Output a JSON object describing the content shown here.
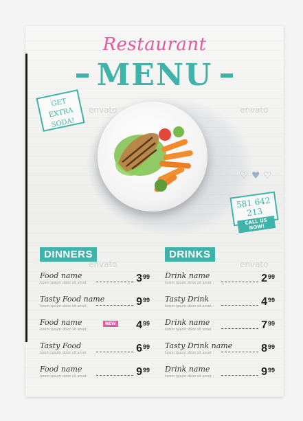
{
  "header": {
    "restaurant": "Restaurant",
    "menu_title": "MENU"
  },
  "stamp": {
    "line1": "GET EXTRA",
    "line2": "SODA!"
  },
  "watermark": "envato",
  "phone_badge": {
    "number": "581 642 213",
    "cta": "CALL US NOW!"
  },
  "dinners": {
    "heading": "DINNERS",
    "items": [
      {
        "name": "Food name",
        "desc": "lorem ipsum dolor sit amet",
        "price": "3",
        "cents": "99",
        "badge": ""
      },
      {
        "name": "Tasty Food name",
        "desc": "lorem ipsum dolor sit amet",
        "price": "9",
        "cents": "99",
        "badge": ""
      },
      {
        "name": "Food name",
        "desc": "lorem ipsum dolor sit amet",
        "price": "4",
        "cents": "99",
        "badge": "NEW"
      },
      {
        "name": "Tasty Food",
        "desc": "lorem ipsum dolor sit amet",
        "price": "6",
        "cents": "99",
        "badge": ""
      },
      {
        "name": "Food name",
        "desc": "lorem ipsum dolor sit amet",
        "price": "9",
        "cents": "99",
        "badge": ""
      }
    ]
  },
  "drinks": {
    "heading": "DRINKS",
    "items": [
      {
        "name": "Drink name",
        "desc": "lorem ipsum dolor sit amet",
        "price": "2",
        "cents": "99"
      },
      {
        "name": "Tasty Drink",
        "desc": "lorem ipsum dolor sit amet",
        "price": "4",
        "cents": "99"
      },
      {
        "name": "Drink name",
        "desc": "lorem ipsum dolor sit amet",
        "price": "7",
        "cents": "99"
      },
      {
        "name": "Tasty Drink name",
        "desc": "lorem ipsum dolor sit amet",
        "price": "8",
        "cents": "99"
      },
      {
        "name": "Drink name",
        "desc": "lorem ipsum dolor sit amet",
        "price": "9",
        "cents": "99"
      }
    ]
  },
  "colors": {
    "teal": "#3fb3aa",
    "pink": "#e05aa0"
  }
}
